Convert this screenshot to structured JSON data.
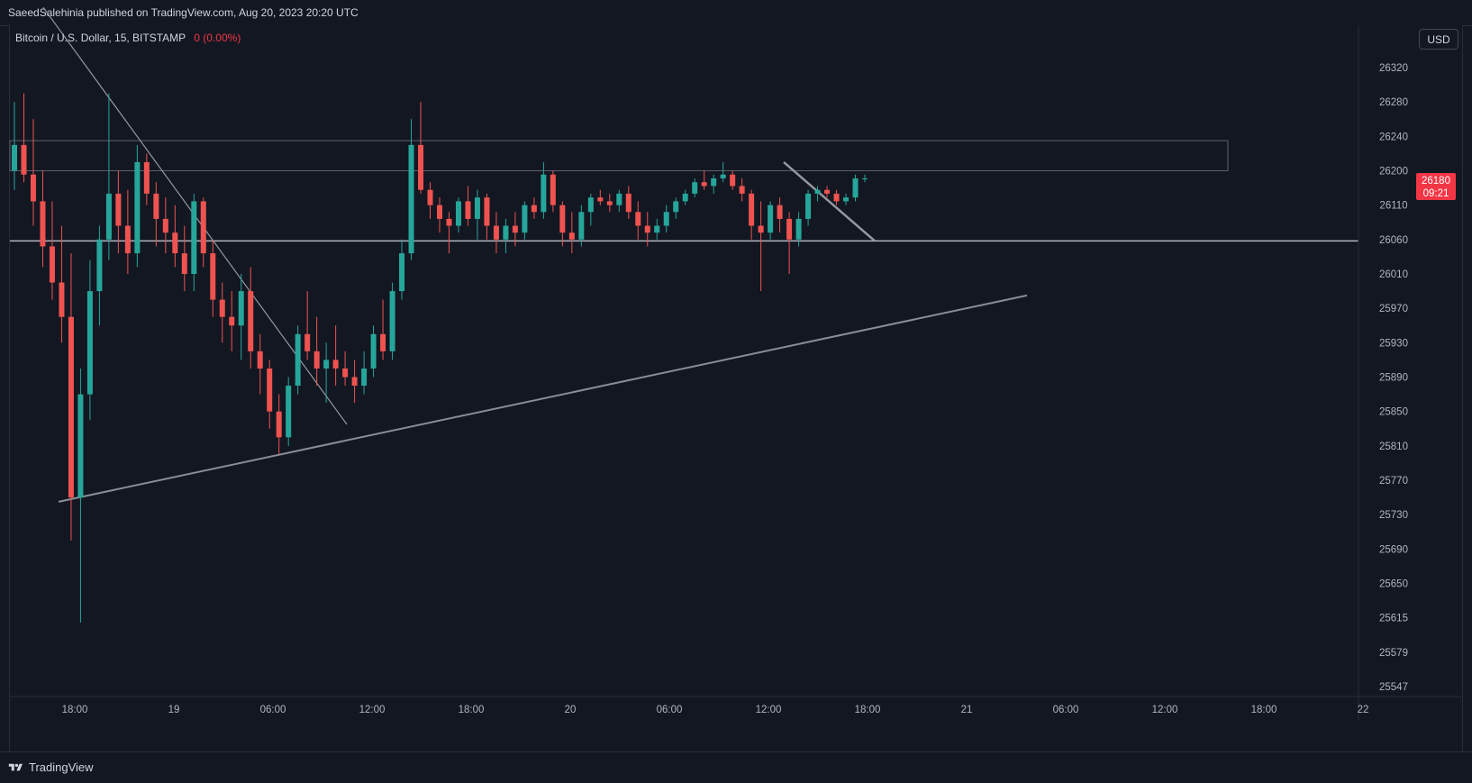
{
  "header": {
    "published_text": "SaeedSalehinia published on TradingView.com, Aug 20, 2023 20:20 UTC"
  },
  "legend": {
    "symbol": "Bitcoin / U.S. Dollar, 15, BITSTAMP",
    "change": "0 (0.00%)"
  },
  "currency_button": "USD",
  "footer": {
    "brand": "TradingView"
  },
  "colors": {
    "background": "#131722",
    "up": "#26a69a",
    "down": "#ef5350",
    "drawing": "#9598a1",
    "price_label": "#f23645"
  },
  "chart_data": {
    "type": "candlestick",
    "title": "Bitcoin / U.S. Dollar, 15, BITSTAMP",
    "ylim": [
      25530,
      26360
    ],
    "y_ticks": [
      26320,
      26280,
      26240,
      26200,
      26110,
      26060,
      26010,
      25970,
      25930,
      25890,
      25850,
      25810,
      25770,
      25730,
      25690,
      25650,
      25615,
      25579,
      25547
    ],
    "x_ticks": [
      "18:00",
      "19",
      "06:00",
      "12:00",
      "18:00",
      "20",
      "06:00",
      "12:00",
      "18:00",
      "21",
      "06:00",
      "12:00",
      "18:00",
      "22"
    ],
    "current_price": {
      "value": "26180",
      "countdown": "09:21"
    },
    "ohlc": [
      [
        26200,
        26280,
        26150,
        26230
      ],
      [
        26230,
        26290,
        26170,
        26190
      ],
      [
        26190,
        26260,
        26080,
        26120
      ],
      [
        26120,
        26200,
        26020,
        26050
      ],
      [
        26050,
        26120,
        25980,
        26000
      ],
      [
        26000,
        26080,
        25930,
        25960
      ],
      [
        25960,
        26040,
        25700,
        25750
      ],
      [
        25750,
        25900,
        25610,
        25870
      ],
      [
        25870,
        26030,
        25840,
        25990
      ],
      [
        25990,
        26080,
        25950,
        26060
      ],
      [
        26060,
        26290,
        26030,
        26140
      ],
      [
        26140,
        26200,
        26040,
        26080
      ],
      [
        26080,
        26150,
        26010,
        26040
      ],
      [
        26040,
        26230,
        26020,
        26210
      ],
      [
        26210,
        26220,
        26110,
        26140
      ],
      [
        26140,
        26170,
        26050,
        26090
      ],
      [
        26090,
        26130,
        26040,
        26070
      ],
      [
        26070,
        26110,
        26020,
        26040
      ],
      [
        26040,
        26080,
        25990,
        26010
      ],
      [
        26010,
        26140,
        25990,
        26120
      ],
      [
        26120,
        26130,
        26020,
        26040
      ],
      [
        26040,
        26060,
        25960,
        25980
      ],
      [
        25980,
        26000,
        25930,
        25960
      ],
      [
        25960,
        25990,
        25920,
        25950
      ],
      [
        25950,
        26010,
        25910,
        25990
      ],
      [
        25990,
        26020,
        25900,
        25920
      ],
      [
        25920,
        25940,
        25870,
        25900
      ],
      [
        25900,
        25910,
        25830,
        25850
      ],
      [
        25850,
        25870,
        25800,
        25820
      ],
      [
        25820,
        25890,
        25810,
        25880
      ],
      [
        25880,
        25950,
        25870,
        25940
      ],
      [
        25940,
        25990,
        25910,
        25920
      ],
      [
        25920,
        25960,
        25880,
        25900
      ],
      [
        25900,
        25930,
        25860,
        25910
      ],
      [
        25910,
        25950,
        25880,
        25900
      ],
      [
        25900,
        25920,
        25880,
        25890
      ],
      [
        25890,
        25910,
        25860,
        25880
      ],
      [
        25880,
        25920,
        25870,
        25900
      ],
      [
        25900,
        25950,
        25890,
        25940
      ],
      [
        25940,
        25980,
        25910,
        25920
      ],
      [
        25920,
        26000,
        25910,
        25990
      ],
      [
        25990,
        26060,
        25980,
        26040
      ],
      [
        26040,
        26260,
        26030,
        26230
      ],
      [
        26230,
        26280,
        26140,
        26150
      ],
      [
        26150,
        26170,
        26090,
        26110
      ],
      [
        26110,
        26130,
        26070,
        26090
      ],
      [
        26090,
        26100,
        26040,
        26080
      ],
      [
        26080,
        26130,
        26070,
        26120
      ],
      [
        26120,
        26160,
        26080,
        26090
      ],
      [
        26090,
        26150,
        26060,
        26130
      ],
      [
        26130,
        26140,
        26060,
        26080
      ],
      [
        26080,
        26100,
        26040,
        26060
      ],
      [
        26060,
        26090,
        26040,
        26080
      ],
      [
        26080,
        26100,
        26050,
        26070
      ],
      [
        26070,
        26120,
        26060,
        26110
      ],
      [
        26110,
        26130,
        26090,
        26100
      ],
      [
        26100,
        26210,
        26090,
        26190
      ],
      [
        26190,
        26200,
        26100,
        26110
      ],
      [
        26110,
        26120,
        26050,
        26070
      ],
      [
        26070,
        26100,
        26040,
        26060
      ],
      [
        26060,
        26110,
        26050,
        26100
      ],
      [
        26100,
        26140,
        26080,
        26130
      ],
      [
        26130,
        26150,
        26110,
        26120
      ],
      [
        26120,
        26140,
        26100,
        26110
      ],
      [
        26110,
        26150,
        26100,
        26140
      ],
      [
        26140,
        26160,
        26090,
        26100
      ],
      [
        26100,
        26120,
        26060,
        26080
      ],
      [
        26080,
        26100,
        26050,
        26070
      ],
      [
        26070,
        26090,
        26060,
        26080
      ],
      [
        26080,
        26110,
        26070,
        26100
      ],
      [
        26100,
        26130,
        26090,
        26120
      ],
      [
        26120,
        26150,
        26110,
        26140
      ],
      [
        26140,
        26180,
        26130,
        26170
      ],
      [
        26170,
        26200,
        26150,
        26160
      ],
      [
        26160,
        26190,
        26140,
        26180
      ],
      [
        26180,
        26210,
        26170,
        26190
      ],
      [
        26190,
        26200,
        26150,
        26160
      ],
      [
        26160,
        26180,
        26120,
        26140
      ],
      [
        26140,
        26150,
        26060,
        26080
      ],
      [
        26080,
        26120,
        25990,
        26070
      ],
      [
        26070,
        26120,
        26060,
        26110
      ],
      [
        26110,
        26130,
        26070,
        26090
      ],
      [
        26090,
        26100,
        26010,
        26060
      ],
      [
        26060,
        26100,
        26050,
        26090
      ],
      [
        26090,
        26150,
        26080,
        26140
      ],
      [
        26140,
        26160,
        26120,
        26150
      ],
      [
        26150,
        26160,
        26130,
        26140
      ],
      [
        26140,
        26150,
        26110,
        26120
      ],
      [
        26120,
        26140,
        26110,
        26130
      ],
      [
        26130,
        26190,
        26120,
        26180
      ],
      [
        26180,
        26190,
        26170,
        26180
      ]
    ],
    "drawings": {
      "resistance_zone": [
        26200,
        26235
      ],
      "support_line": 26058,
      "ascending_trendline": [
        [
          0,
          25745
        ],
        [
          1,
          25985
        ]
      ],
      "descending_trendline_1": [
        [
          0,
          26390
        ],
        [
          1,
          25835
        ]
      ],
      "descending_trendline_2": [
        [
          0,
          26210
        ],
        [
          1,
          26058
        ]
      ]
    }
  }
}
